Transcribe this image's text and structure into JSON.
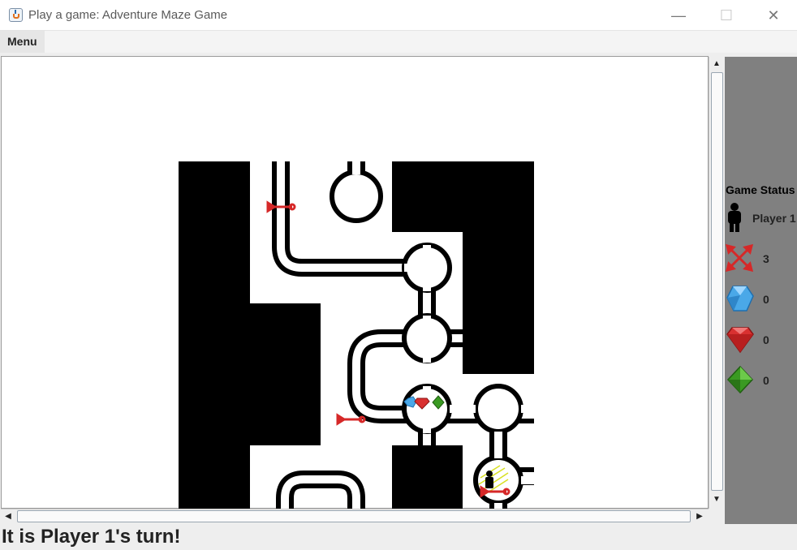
{
  "window": {
    "title": "Play a game: Adventure Maze Game",
    "minimize_glyph": "—",
    "maximize_glyph": "☐",
    "close_glyph": "✕"
  },
  "menubar": {
    "menu_label": "Menu"
  },
  "status_panel": {
    "title": "Game Status",
    "player_icon": "player-silhouette-icon",
    "player_name": "Player 1",
    "arrows": {
      "icon": "crossed-arrows-icon",
      "count": "3"
    },
    "blue_gems": {
      "icon": "blue-diamond-icon",
      "count": "0"
    },
    "red_gems": {
      "icon": "red-ruby-icon",
      "count": "0"
    },
    "green_gems": {
      "icon": "green-emerald-icon",
      "count": "0"
    }
  },
  "turn_message": "It is Player 1's turn!",
  "colors": {
    "wall": "#000000",
    "panel_bg": "#808080",
    "arrow_red": "#d62828",
    "gem_blue": "#4aa8e8",
    "gem_red": "#d93030",
    "gem_green": "#3a9a22",
    "pit_yellow": "#d8e020"
  }
}
